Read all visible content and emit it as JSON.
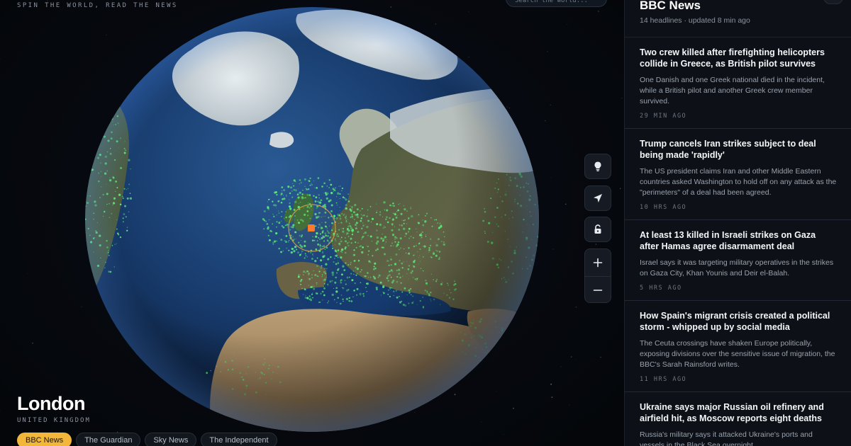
{
  "app": {
    "tagline": "SPIN THE WORLD, READ THE NEWS",
    "search_placeholder": "Search the world..."
  },
  "location": {
    "city": "London",
    "country": "UNITED KINGDOM"
  },
  "sources": [
    {
      "label": "BBC News",
      "active": true
    },
    {
      "label": "The Guardian",
      "active": false
    },
    {
      "label": "Sky News",
      "active": false
    },
    {
      "label": "The Independent",
      "active": false
    }
  ],
  "controls": {
    "icons": [
      "lightbulb-icon",
      "navigation-arrow-icon",
      "unlock-icon",
      "plus-icon",
      "minus-icon"
    ]
  },
  "colors": {
    "accent": "#f2b63a",
    "city_lights": "#5cf07a",
    "marker": "#ff7a2a"
  },
  "feed": {
    "title": "BBC News",
    "meta": "14 headlines · updated 8 min ago",
    "articles": [
      {
        "title": "Two crew killed after firefighting helicopters collide in Greece, as British pilot survives",
        "summary": "One Danish and one Greek national died in the incident, while a British pilot and another Greek crew member survived.",
        "time": "29 MIN AGO"
      },
      {
        "title": "Trump cancels Iran strikes subject to deal being made 'rapidly'",
        "summary": "The US president claims Iran and other Middle Eastern countries asked Washington to hold off on any attack as the \"perimeters\" of a deal had been agreed.",
        "time": "10 HRS AGO"
      },
      {
        "title": "At least 13 killed in Israeli strikes on Gaza after Hamas agree disarmament deal",
        "summary": "Israel says it was targeting military operatives in the strikes on Gaza City, Khan Younis and Deir el-Balah.",
        "time": "5 HRS AGO"
      },
      {
        "title": "How Spain's migrant crisis created a political storm - whipped up by social media",
        "summary": "The Ceuta crossings have shaken Europe politically, exposing divisions over the sensitive issue of migration, the BBC's Sarah Rainsford writes.",
        "time": "11 HRS AGO"
      },
      {
        "title": "Ukraine says major Russian oil refinery and airfield hit, as Moscow reports eight deaths",
        "summary": "Russia's military says it attacked Ukraine's ports and vessels in the Black Sea overnight.",
        "time": ""
      }
    ]
  }
}
